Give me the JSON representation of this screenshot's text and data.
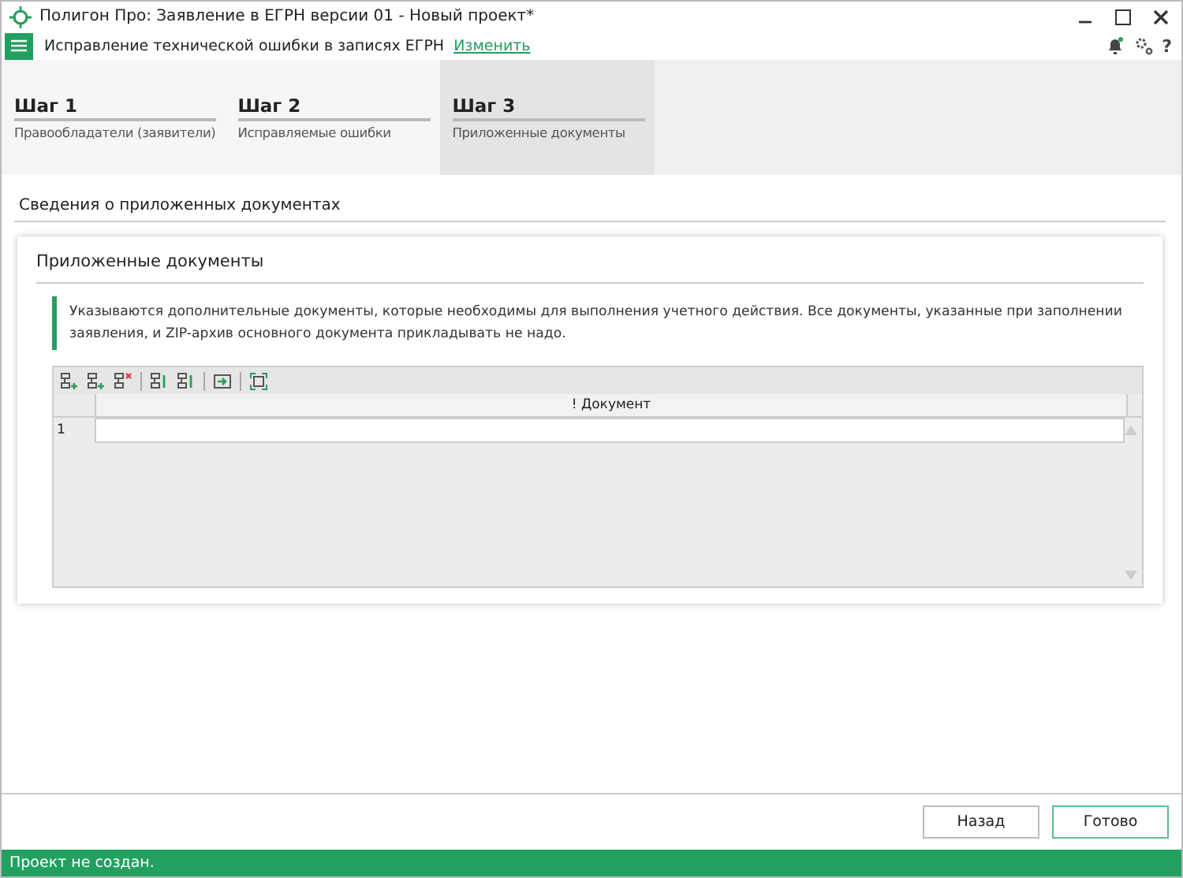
{
  "window": {
    "title": "Полигон Про: Заявление в ЕГРН версии 01 - Новый проект*"
  },
  "header": {
    "title": "Исправление технической ошибки в записях ЕГРН",
    "link": "Изменить",
    "help": "?"
  },
  "steps": [
    {
      "step": "Шаг 1",
      "label": "Правообладатели (заявители)",
      "selected": false
    },
    {
      "step": "Шаг 2",
      "label": "Исправляемые ошибки",
      "selected": false
    },
    {
      "step": "Шаг 3",
      "label": "Приложенные документы",
      "selected": true
    }
  ],
  "section_title": "Сведения о приложенных документах",
  "card": {
    "title": "Приложенные документы",
    "note": "Указываются дополнительные документы, которые необходимы для выполнения учетного действия. Все документы, указанные при заполнении заявления, и ZIP-архив основного документа прикладывать не надо."
  },
  "grid": {
    "columns": [
      "! Документ"
    ],
    "rows": [
      {
        "number": "1"
      }
    ]
  },
  "buttons": [
    {
      "label": "Назад",
      "kind": "secondary"
    },
    {
      "label": "Готово",
      "kind": "primary"
    }
  ],
  "status_bar": "Проект не создан."
}
